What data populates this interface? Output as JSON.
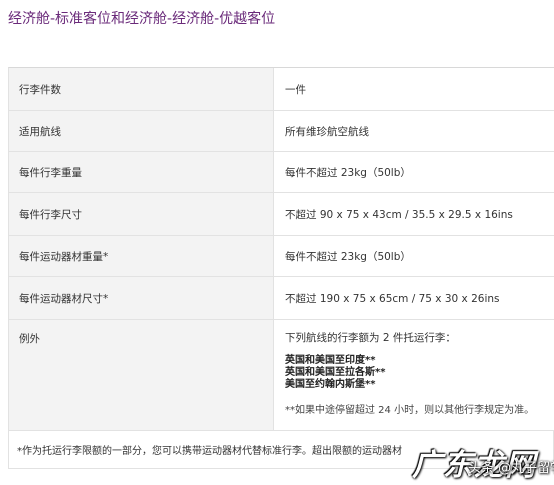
{
  "title": "经济舱-标准客位和经济舱-经济舱-优越客位",
  "rows": [
    {
      "label": "行李件数",
      "value": "一件"
    },
    {
      "label": "适用航线",
      "value": "所有维珍航空航线"
    },
    {
      "label": "每件行李重量",
      "value": "每件不超过 23kg（50lb）"
    },
    {
      "label": "每件行李尺寸",
      "value": "不超过 90 x 75 x 43cm  /  35.5 x 29.5 x 16ins"
    },
    {
      "label": "每件运动器材重量*",
      "value": "每件不超过 23kg（50lb）"
    },
    {
      "label": "每件运动器材尺寸*",
      "value": "不超过 190 x 75 x 65cm  /  75 x 30 x 26ins"
    }
  ],
  "exception": {
    "label": "例外",
    "intro": "下列航线的行李额为 2 件托运行李：",
    "routes": [
      "英国和美国至印度**",
      "英国和美国至拉各斯**",
      "美国至约翰内斯堡**"
    ],
    "note": "**如果中途停留超过 24 小时，则以其他行李规定为准。"
  },
  "footnote": "*作为托运行李限额的一部分，您可以携带运动器材代替标准行李。超出限额的运动器材",
  "watermark": {
    "main": "广东龙网",
    "sub": "头条 @丸子留学"
  }
}
